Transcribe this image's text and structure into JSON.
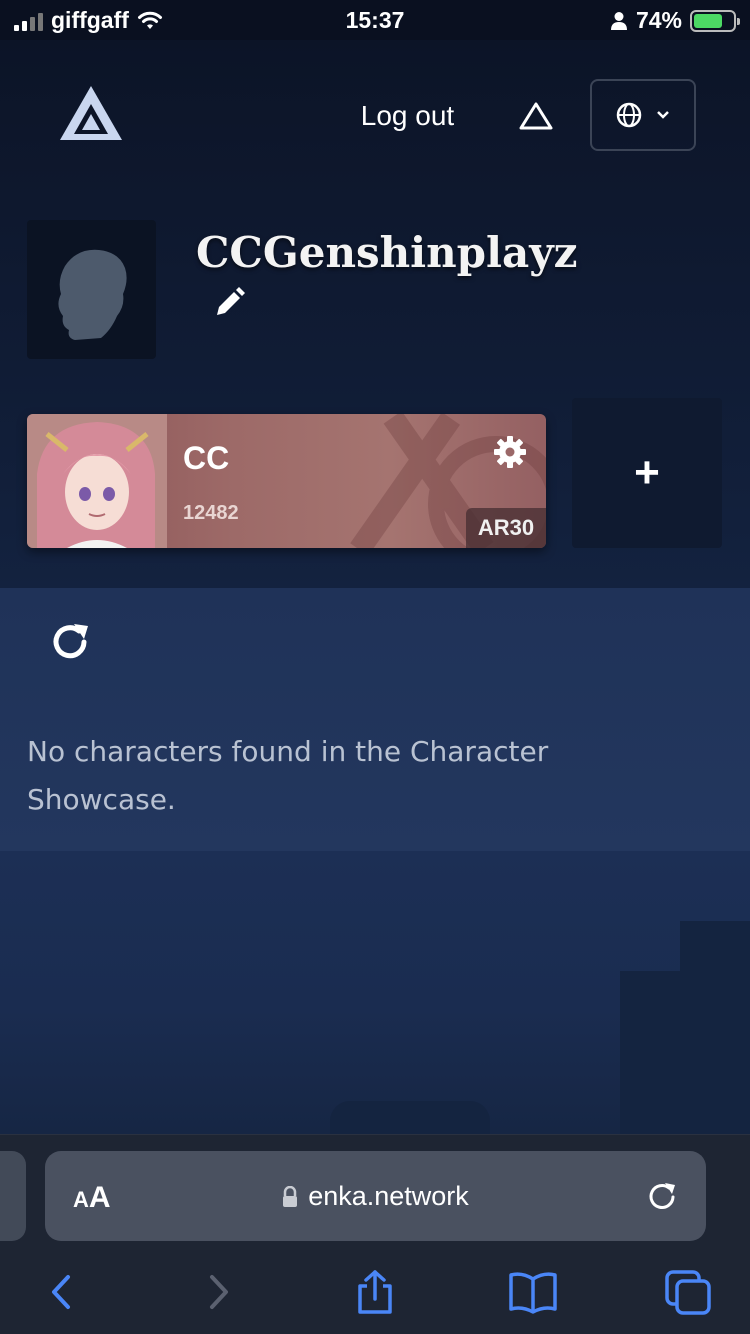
{
  "status_bar": {
    "carrier": "giffgaff",
    "time": "15:37",
    "battery": "74%",
    "battery_level": 0.74,
    "icons": [
      "signal-icon",
      "wifi-icon",
      "person-icon",
      "battery-charging-icon"
    ]
  },
  "header": {
    "logo": "enka-logo-icon",
    "logout_label": "Log out",
    "triangle_icon": "triangle-icon",
    "language_icon": "globe-icon"
  },
  "profile": {
    "username": "CCGenshinplayz",
    "edit_icon": "pencil-icon"
  },
  "accounts": [
    {
      "name": "CC",
      "uid": "12482",
      "ar": "AR30"
    }
  ],
  "add_account_label": "+",
  "showcase": {
    "empty_message": "No characters found in the Character Showcase."
  },
  "browser": {
    "aa_small": "A",
    "aa_big": "A",
    "url": "enka.network",
    "toolbar_icons": [
      "back-icon",
      "forward-icon",
      "share-icon",
      "bookmarks-icon",
      "tabs-icon"
    ],
    "accent": "#4a86f7"
  }
}
